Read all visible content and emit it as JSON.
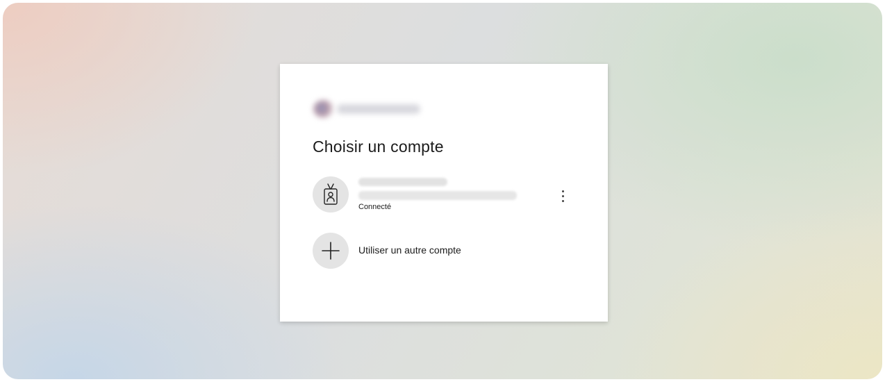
{
  "dialog": {
    "title": "Choisir un compte"
  },
  "account": {
    "status": "Connecté",
    "avatar_icon": "badge-person-icon",
    "menu_icon": "more-vertical-icon"
  },
  "add_account": {
    "label": "Utiliser un autre compte",
    "icon": "plus-icon"
  },
  "colors": {
    "card_background": "#ffffff",
    "text": "#1b1b1b",
    "icon_circle": "#e4e4e4"
  }
}
